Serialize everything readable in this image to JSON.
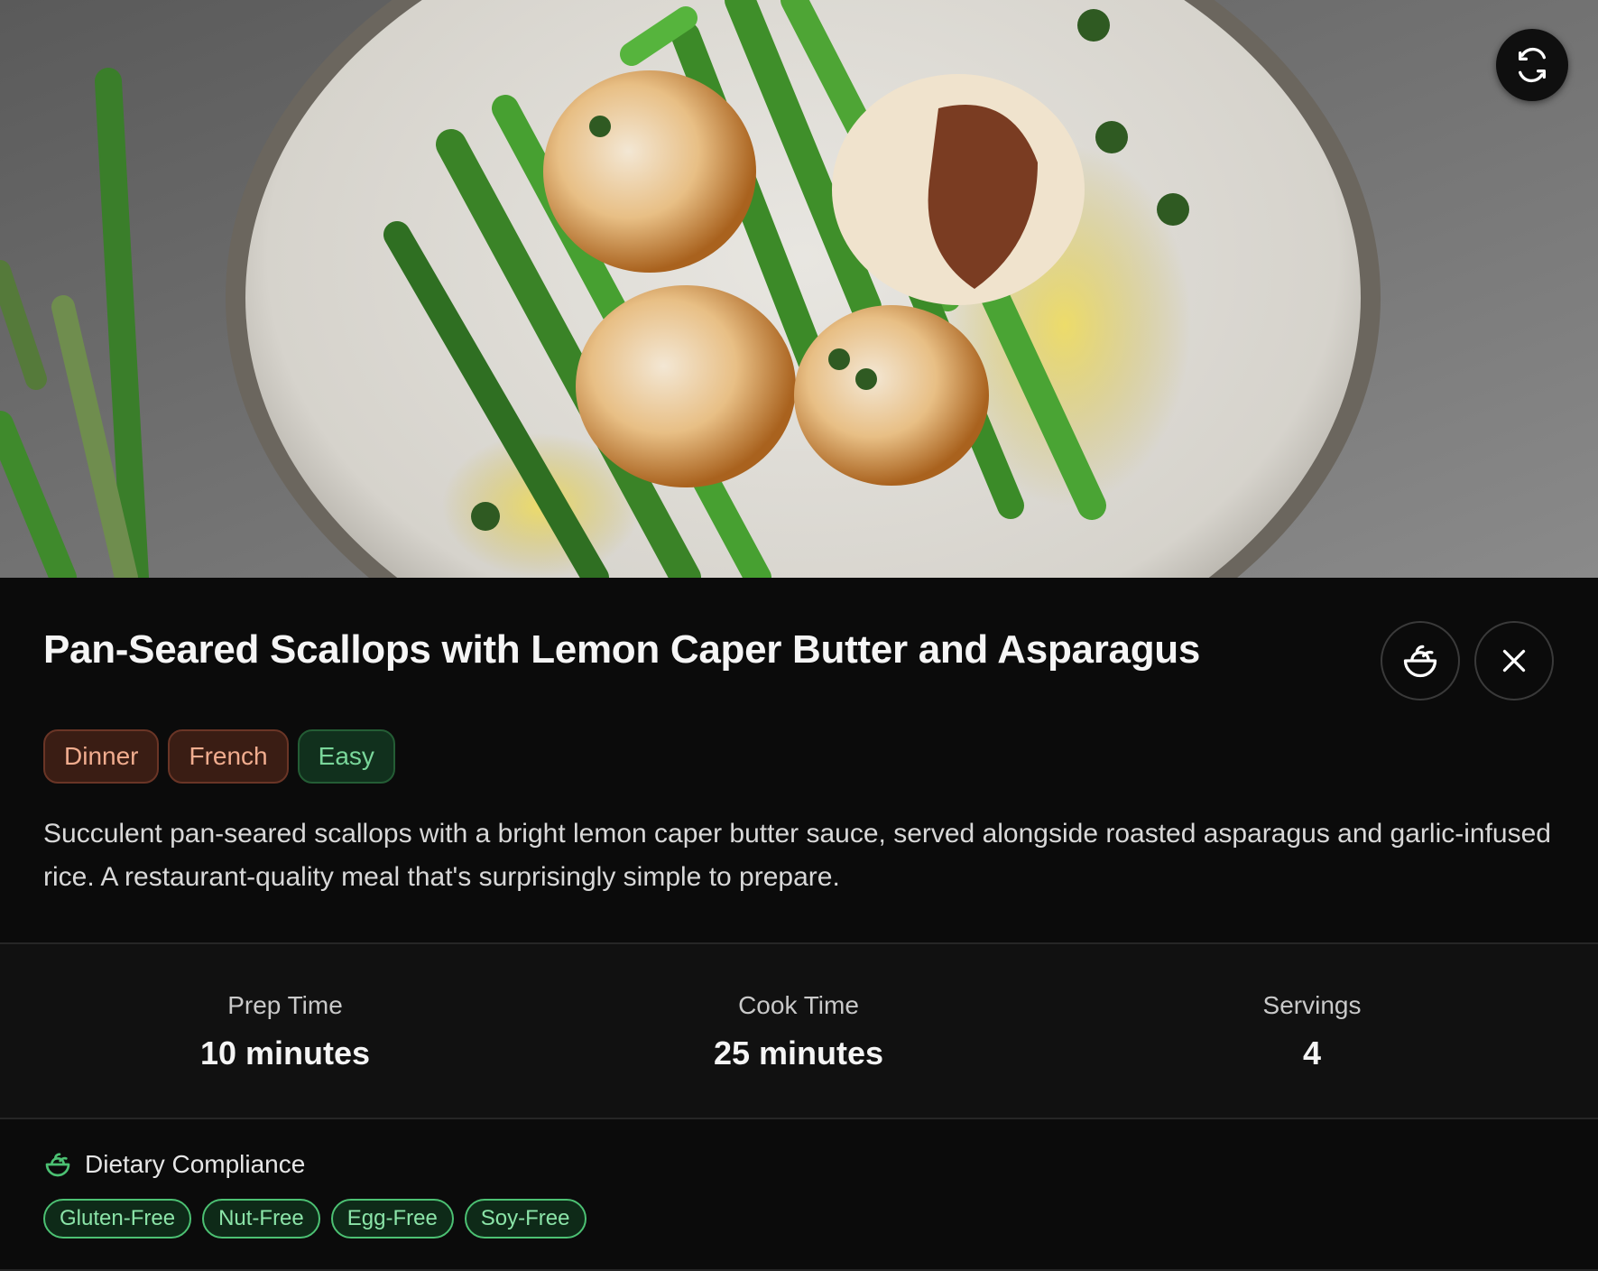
{
  "hero": {
    "refresh_icon": "refresh-icon"
  },
  "recipe": {
    "title": "Pan-Seared Scallops with Lemon Caper Butter and Asparagus",
    "tags": [
      {
        "label": "Dinner",
        "style": "warm"
      },
      {
        "label": "French",
        "style": "warm"
      },
      {
        "label": "Easy",
        "style": "green"
      }
    ],
    "description": "Succulent pan-seared scallops with a bright lemon caper butter sauce, served alongside roasted asparagus and garlic-infused rice. A restaurant-quality meal that's surprisingly simple to prepare."
  },
  "actions": {
    "diet_icon": "salad-bowl-icon",
    "close_icon": "close-icon"
  },
  "stats": {
    "prep": {
      "label": "Prep Time",
      "value": "10 minutes"
    },
    "cook": {
      "label": "Cook Time",
      "value": "25 minutes"
    },
    "servings": {
      "label": "Servings",
      "value": "4"
    }
  },
  "dietary": {
    "heading": "Dietary Compliance",
    "icon": "salad-bowl-icon",
    "items": [
      "Gluten-Free",
      "Nut-Free",
      "Egg-Free",
      "Soy-Free"
    ]
  },
  "colors": {
    "background": "#0b0b0b",
    "warm_tag_bg": "#3a1d14",
    "warm_tag_text": "#f1ad8f",
    "green_tag_bg": "#11301d",
    "green_tag_text": "#79d69a",
    "diet_border": "#4cc173"
  }
}
